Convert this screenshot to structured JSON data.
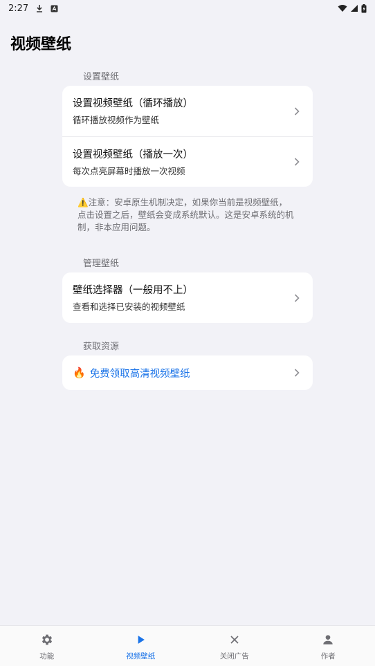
{
  "status_bar": {
    "time": "2:27"
  },
  "page": {
    "title": "视频壁纸"
  },
  "sections": {
    "set": {
      "header": "设置壁纸",
      "items": [
        {
          "title": "设置视频壁纸（循环播放）",
          "subtitle": "循环播放视频作为壁纸"
        },
        {
          "title": "设置视频壁纸（播放一次）",
          "subtitle": "每次点亮屏幕时播放一次视频"
        }
      ]
    },
    "note": {
      "line1": "⚠️注意：安卓原生机制决定，如果你当前是视频壁纸，",
      "line2": "点击设置之后，壁纸会变成系统默认。这是安卓系统的机",
      "line3": "制，非本应用问题。"
    },
    "manage": {
      "header": "管理壁纸",
      "items": [
        {
          "title": "壁纸选择器（一般用不上）",
          "subtitle": "查看和选择已安装的视频壁纸"
        }
      ]
    },
    "resources": {
      "header": "获取资源",
      "promo": {
        "emoji": "🔥",
        "label": "免费领取高清视频壁纸"
      }
    }
  },
  "tabs": [
    {
      "label": "功能",
      "icon": "gear-icon"
    },
    {
      "label": "视频壁纸",
      "icon": "play-icon",
      "active": true
    },
    {
      "label": "关闭广告",
      "icon": "close-icon"
    },
    {
      "label": "作者",
      "icon": "person-icon"
    }
  ],
  "colors": {
    "accent": "#1a73e8",
    "background": "#f2f2f7",
    "card": "#ffffff"
  }
}
